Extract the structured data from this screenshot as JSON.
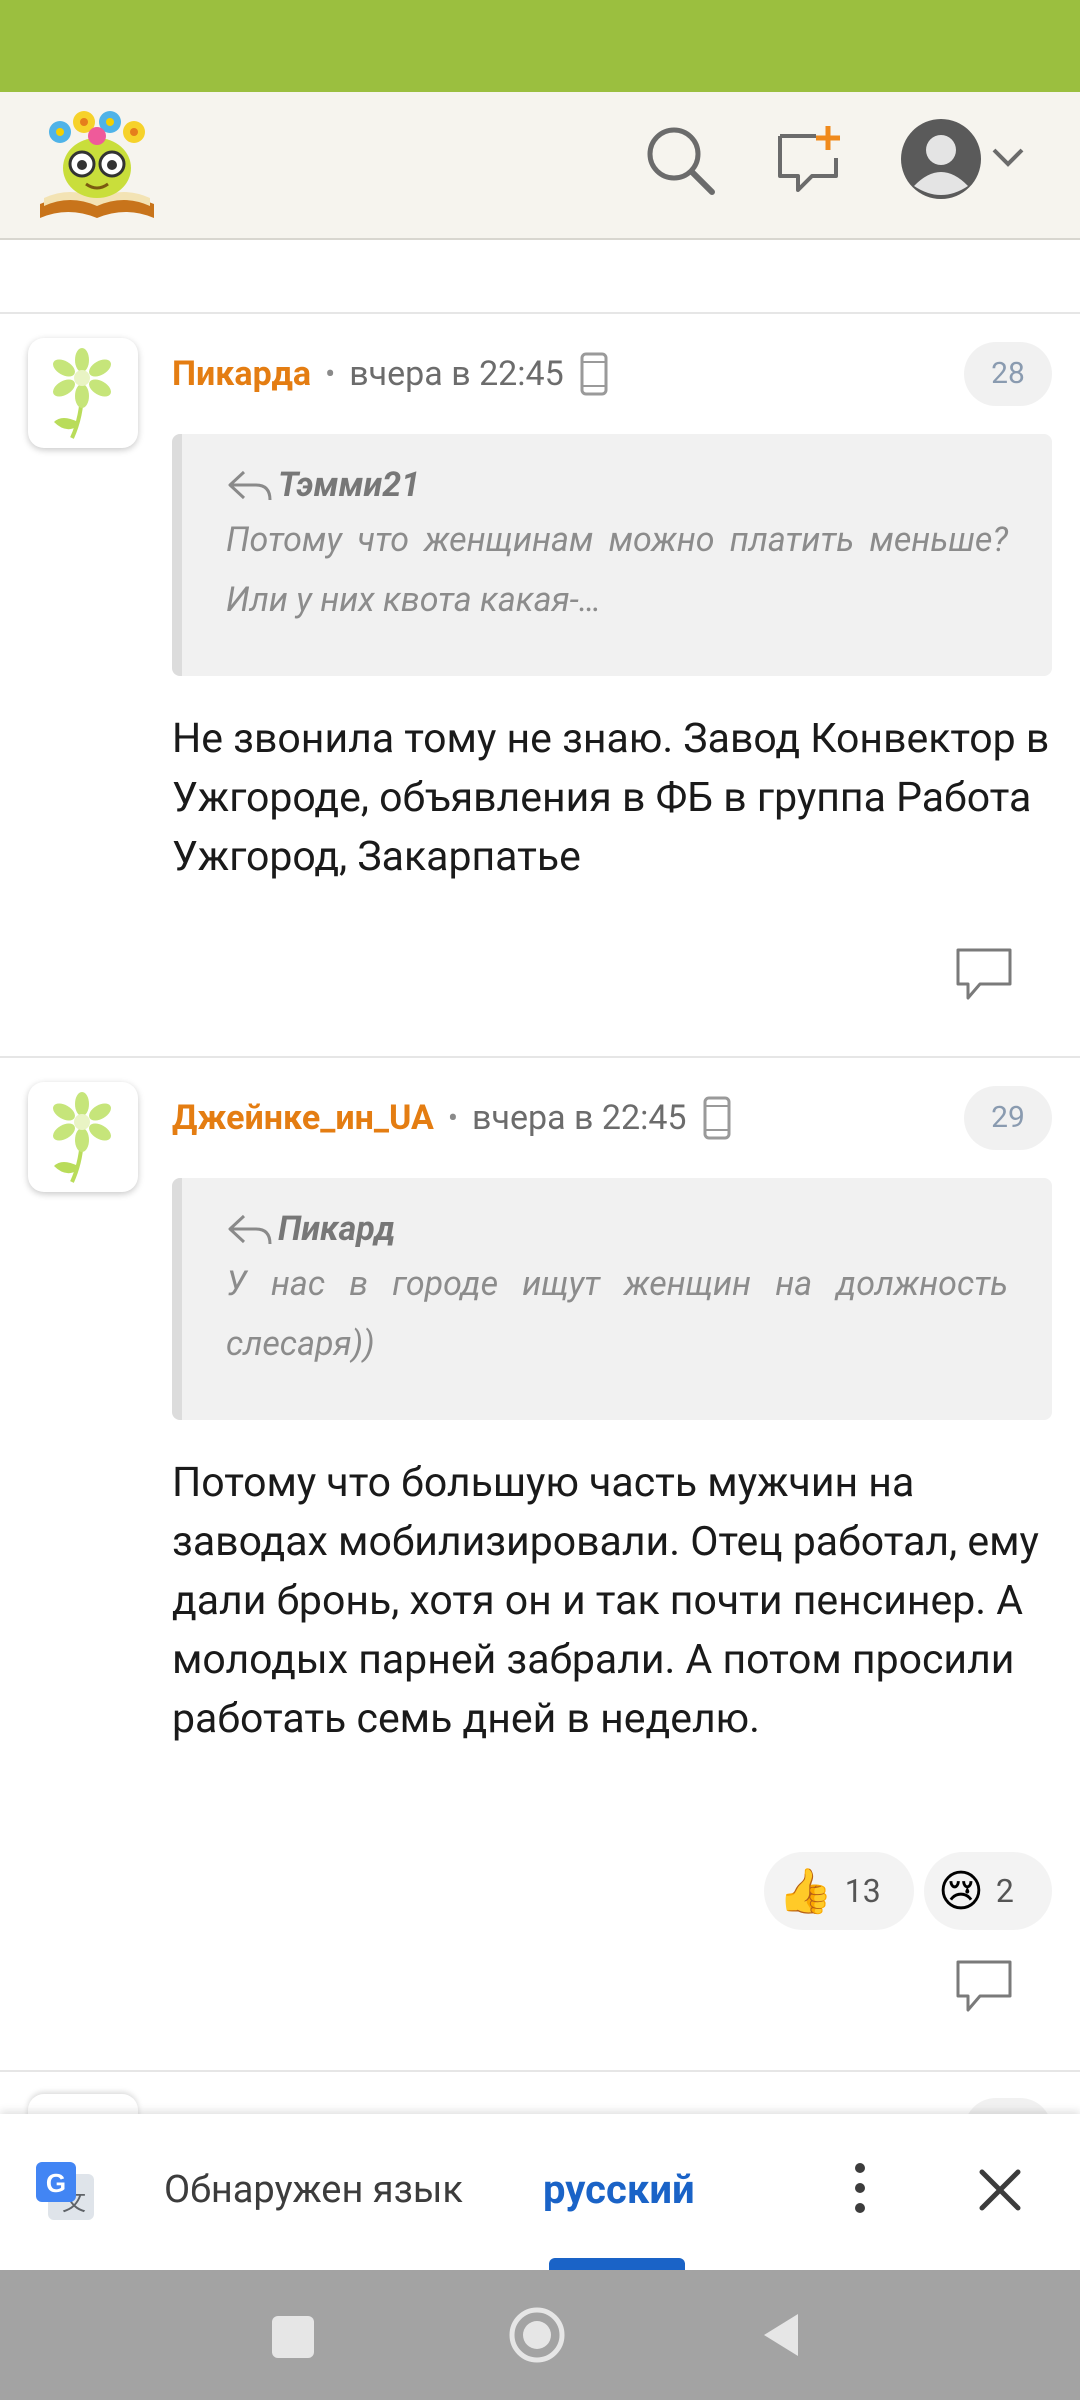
{
  "colors": {
    "status_bar": "#9bbf3f",
    "username": "#e47d12",
    "link_blue": "#1a63c7"
  },
  "header": {
    "logo": "flower-book-logo",
    "icons": [
      "search-icon",
      "new-post-icon",
      "profile-avatar-icon",
      "chevron-down-icon"
    ]
  },
  "comments": [
    {
      "author": "Пикарда",
      "time": "вчера в 22:45",
      "number": "28",
      "quote_author": "Тэмми21",
      "quote_text": "Потому что женщинам можно платить меньше? Или у них квота какая-…",
      "text": "Не звонила тому не знаю. Завод Конвектор в Ужгороде, объявления в ФБ в группа Работа Ужгород, Закарпатье"
    },
    {
      "author": "Джейнке_ин_UA",
      "time": "вчера в 22:45",
      "number": "29",
      "quote_author": "Пикард",
      "quote_text": "У нас в городе ищут женщин на должность слесаря))",
      "text": "Потому что большую часть мужчин на заводах мобилизировали. Отец работал, ему дали бронь, хотя он и так почти пенсинер. А молодых парней забрали. А потом просили работать семь дней в неделю.",
      "reactions": [
        {
          "emoji": "👍",
          "count": "13"
        },
        {
          "emoji": "😢",
          "count": "2"
        }
      ]
    }
  ],
  "translate_bar": {
    "detected_label": "Обнаружен язык",
    "language": "русский"
  },
  "nav": {
    "buttons": [
      "recent-apps-button",
      "home-button",
      "back-button"
    ]
  }
}
